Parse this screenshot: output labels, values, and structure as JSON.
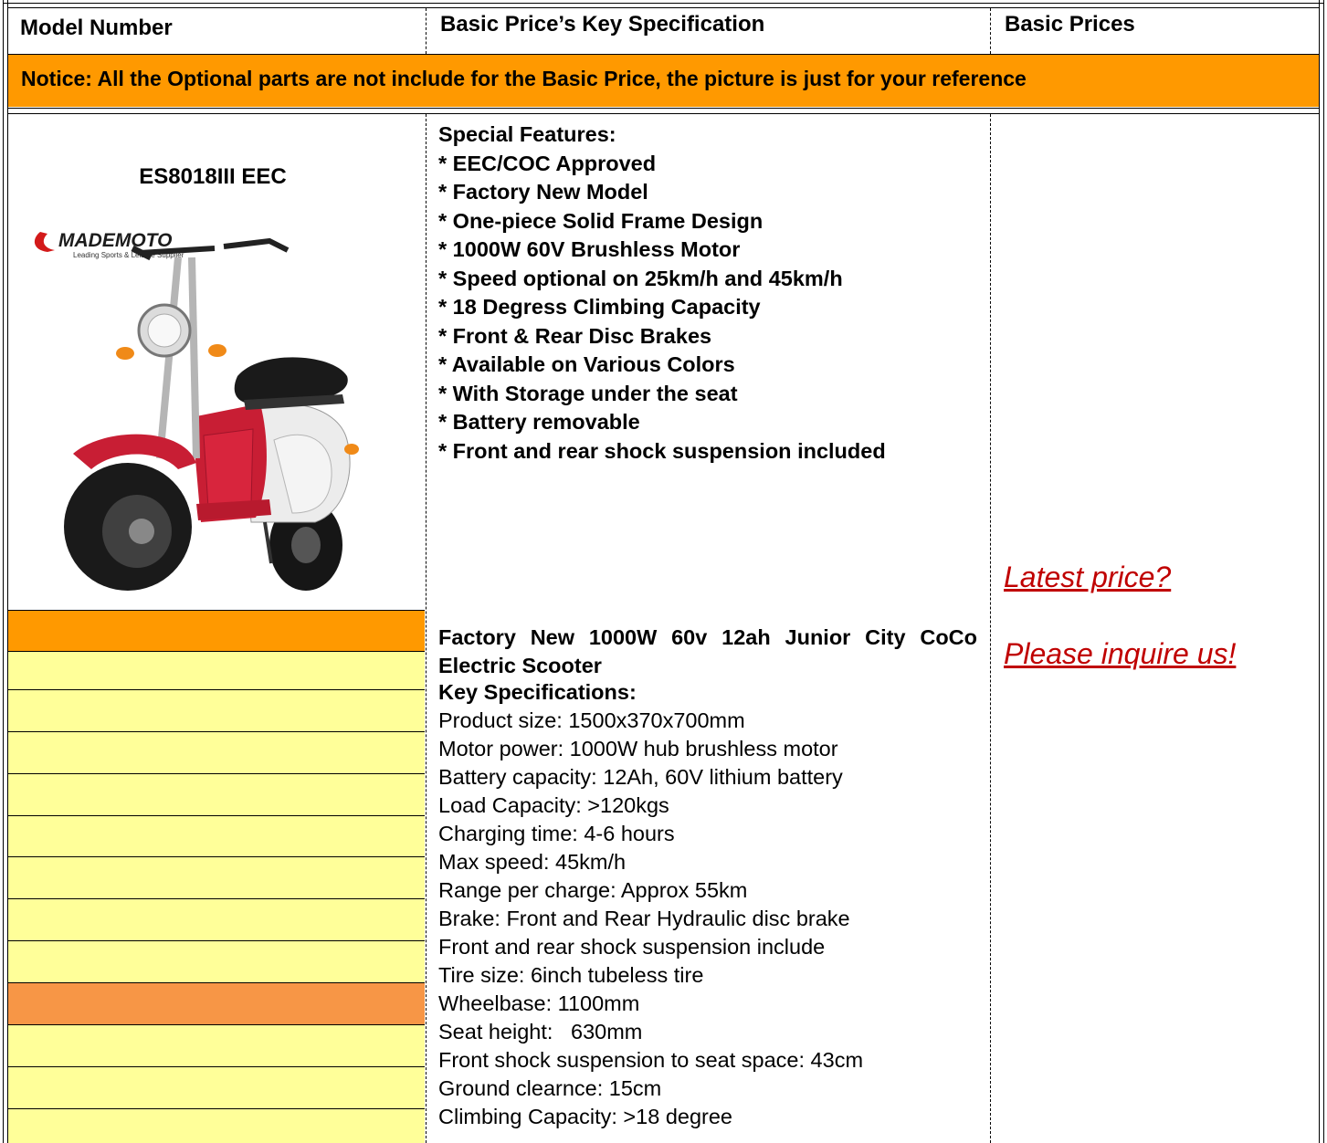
{
  "header": {
    "col_model": "Model Number",
    "col_spec": "Basic Price’s Key Specification",
    "col_price": "Basic Prices"
  },
  "notice": "Notice: All the Optional parts are not include for the Basic Price, the picture is just for your reference",
  "product": {
    "model": "ES8018III EEC",
    "logo_text": "MADEMOTO",
    "logo_tagline": "Leading Sports & Leisure Supplier",
    "features_title": "Special Features:",
    "features": [
      "* EEC/COC Approved",
      "* Factory New Model",
      "* One-piece Solid Frame Design",
      "* 1000W 60V Brushless Motor",
      "* Speed optional on 25km/h and 45km/h",
      "* 18 Degress Climbing Capacity",
      "* Front & Rear Disc Brakes",
      "* Available on Various Colors",
      "* With Storage under the seat",
      "* Battery removable",
      "* Front and rear shock suspension included"
    ],
    "title": "Factory New 1000W 60v 12ah Junior City CoCo Electric Scooter",
    "specs_title": "Key Specifications:",
    "specs": [
      "Product size: 1500x370x700mm",
      "Motor power: 1000W hub brushless motor",
      "Battery capacity: 12Ah, 60V lithium battery",
      "Load Capacity: >120kgs",
      "Charging time: 4-6 hours",
      "Max speed: 45km/h",
      "Range per charge: Approx 55km",
      "Brake: Front and Rear Hydraulic disc brake",
      "Front and rear shock suspension include",
      "Tire size: 6inch tubeless tire",
      "Wheelbase: 1100mm",
      "Seat height:   630mm",
      "Front shock suspension to seat space: 43cm",
      "Ground clearnce: 15cm",
      "Climbing Capacity: >18 degree"
    ]
  },
  "price": {
    "line1": "Latest price?",
    "line2": "Please inquire us!"
  },
  "colors": {
    "orange": "#ff9900",
    "light_orange": "#f79646",
    "pale_yellow": "#ffff99",
    "link_red": "#c00000"
  }
}
